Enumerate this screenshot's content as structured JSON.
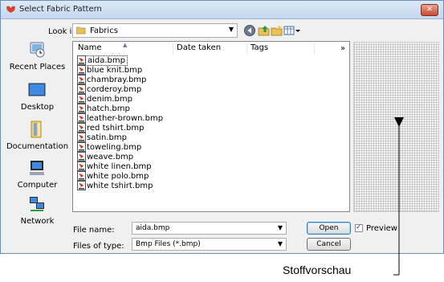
{
  "window": {
    "title": "Select Fabric Pattern",
    "close_label": "✕"
  },
  "lookin": {
    "label": "Look in:",
    "value": "Fabrics"
  },
  "toolbar": {
    "icons": [
      "back-icon",
      "up-folder-icon",
      "new-folder-icon",
      "view-menu-icon"
    ]
  },
  "places": [
    {
      "label": "Recent Places",
      "icon": "recent-places-icon"
    },
    {
      "label": "Desktop",
      "icon": "desktop-icon"
    },
    {
      "label": "Documentation",
      "icon": "documentation-icon"
    },
    {
      "label": "Computer",
      "icon": "computer-icon"
    },
    {
      "label": "Network",
      "icon": "network-icon"
    }
  ],
  "columns": {
    "name": "Name",
    "date": "Date taken",
    "tags": "Tags",
    "more": "»"
  },
  "files": [
    "aida.bmp",
    "blue knit.bmp",
    "chambray.bmp",
    "corderoy.bmp",
    "denim.bmp",
    "hatch.bmp",
    "leather-brown.bmp",
    "red tshirt.bmp",
    "satin.bmp",
    "toweling.bmp",
    "weave.bmp",
    "white linen.bmp",
    "white polo.bmp",
    "white tshirt.bmp"
  ],
  "selected_file": "aida.bmp",
  "filename": {
    "label": "File name:",
    "value": "aida.bmp"
  },
  "filetype": {
    "label": "Files of type:",
    "value": "Bmp Files (*.bmp)"
  },
  "buttons": {
    "open": "Open",
    "cancel": "Cancel"
  },
  "preview": {
    "label": "Preview",
    "checked": true,
    "check_mark": "✓"
  },
  "callout": {
    "text": "Stoffvorschau"
  },
  "colors": {
    "title_bg": "#c4d7ee",
    "dialog_bg": "#f0f0f0",
    "close_red": "#c74a33",
    "folder_yellow": "#e8c15a"
  }
}
